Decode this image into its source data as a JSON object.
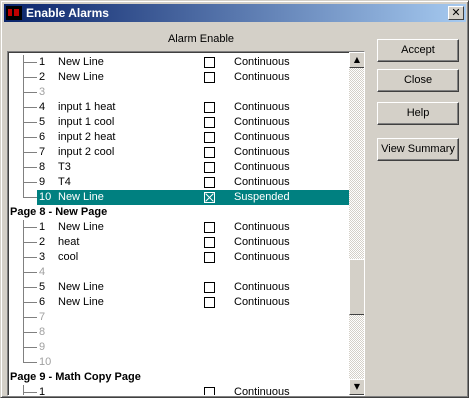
{
  "window": {
    "title": "Enable Alarms",
    "close_glyph": "✕"
  },
  "list": {
    "header": "Alarm Enable",
    "rows": [
      {
        "type": "item",
        "num": "1",
        "name": "New Line",
        "checked": false,
        "mode": "Continuous",
        "disabled": false,
        "selected": false
      },
      {
        "type": "item",
        "num": "2",
        "name": "New Line",
        "checked": false,
        "mode": "Continuous",
        "disabled": false,
        "selected": false
      },
      {
        "type": "item",
        "num": "3",
        "name": "",
        "checked": null,
        "mode": "",
        "disabled": true,
        "selected": false
      },
      {
        "type": "item",
        "num": "4",
        "name": "input 1 heat",
        "checked": false,
        "mode": "Continuous",
        "disabled": false,
        "selected": false
      },
      {
        "type": "item",
        "num": "5",
        "name": "input 1 cool",
        "checked": false,
        "mode": "Continuous",
        "disabled": false,
        "selected": false
      },
      {
        "type": "item",
        "num": "6",
        "name": "input 2 heat",
        "checked": false,
        "mode": "Continuous",
        "disabled": false,
        "selected": false
      },
      {
        "type": "item",
        "num": "7",
        "name": "input 2 cool",
        "checked": false,
        "mode": "Continuous",
        "disabled": false,
        "selected": false
      },
      {
        "type": "item",
        "num": "8",
        "name": "T3",
        "checked": false,
        "mode": "Continuous",
        "disabled": false,
        "selected": false
      },
      {
        "type": "item",
        "num": "9",
        "name": "T4",
        "checked": false,
        "mode": "Continuous",
        "disabled": false,
        "selected": false
      },
      {
        "type": "item",
        "num": "10",
        "name": "New Line",
        "checked": true,
        "mode": "Suspended",
        "disabled": false,
        "selected": true,
        "last": true
      },
      {
        "type": "page",
        "label": "Page 8 - New Page"
      },
      {
        "type": "item",
        "num": "1",
        "name": "New Line",
        "checked": false,
        "mode": "Continuous",
        "disabled": false,
        "selected": false
      },
      {
        "type": "item",
        "num": "2",
        "name": "heat",
        "checked": false,
        "mode": "Continuous",
        "disabled": false,
        "selected": false
      },
      {
        "type": "item",
        "num": "3",
        "name": "cool",
        "checked": false,
        "mode": "Continuous",
        "disabled": false,
        "selected": false
      },
      {
        "type": "item",
        "num": "4",
        "name": "",
        "checked": null,
        "mode": "",
        "disabled": true,
        "selected": false
      },
      {
        "type": "item",
        "num": "5",
        "name": "New Line",
        "checked": false,
        "mode": "Continuous",
        "disabled": false,
        "selected": false
      },
      {
        "type": "item",
        "num": "6",
        "name": "New Line",
        "checked": false,
        "mode": "Continuous",
        "disabled": false,
        "selected": false
      },
      {
        "type": "item",
        "num": "7",
        "name": "",
        "checked": null,
        "mode": "",
        "disabled": true,
        "selected": false
      },
      {
        "type": "item",
        "num": "8",
        "name": "",
        "checked": null,
        "mode": "",
        "disabled": true,
        "selected": false
      },
      {
        "type": "item",
        "num": "9",
        "name": "",
        "checked": null,
        "mode": "",
        "disabled": true,
        "selected": false
      },
      {
        "type": "item",
        "num": "10",
        "name": "",
        "checked": null,
        "mode": "",
        "disabled": true,
        "selected": false,
        "last": true
      },
      {
        "type": "page",
        "label": "Page 9 - Math Copy Page"
      },
      {
        "type": "item",
        "num": "1",
        "name": "",
        "checked": false,
        "mode": "Continuous",
        "disabled": false,
        "selected": false
      }
    ]
  },
  "scrollbar": {
    "up_glyph": "▲",
    "down_glyph": "▼"
  },
  "buttons": {
    "accept": "Accept",
    "close": "Close",
    "help": "Help",
    "view_summary": "View Summary"
  }
}
